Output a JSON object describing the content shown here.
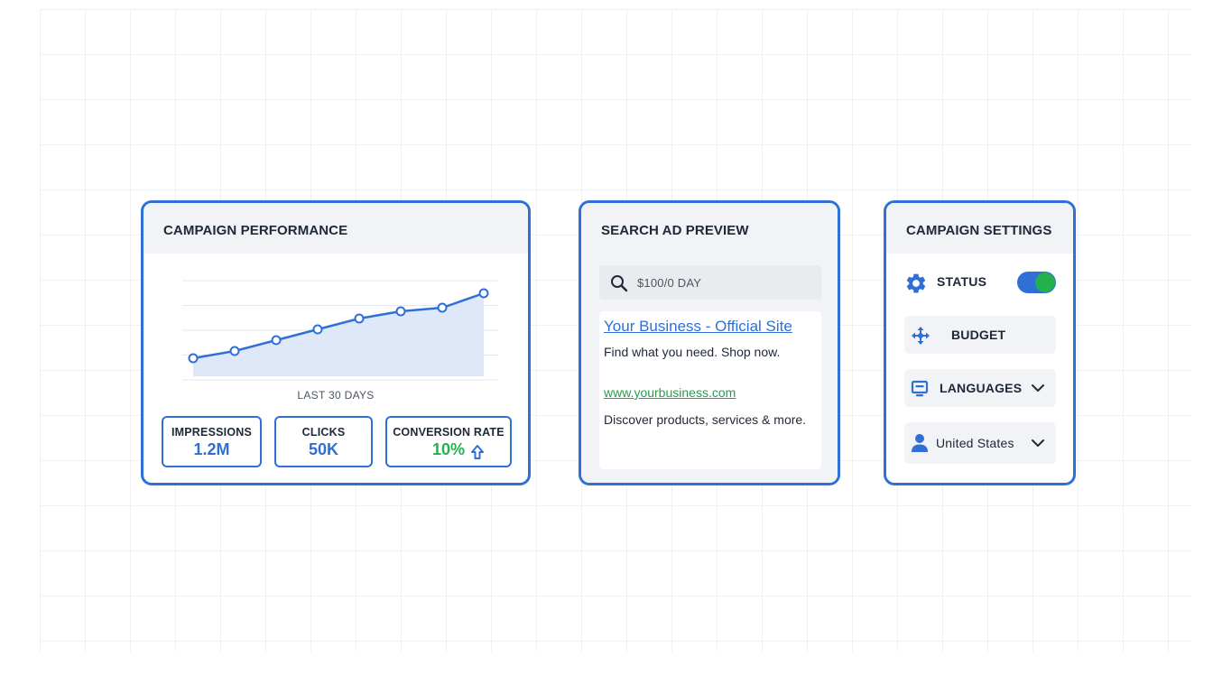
{
  "performance": {
    "title": "CAMPAIGN PERFORMANCE",
    "caption": "LAST 30 DAYS",
    "metrics": [
      {
        "label": "IMPRESSIONS",
        "value": "1.2M"
      },
      {
        "label": "CLICKS",
        "value": "50K"
      },
      {
        "label": "CONVERSION RATE",
        "value": "10%"
      }
    ],
    "trend_icon": "arrow-up-icon"
  },
  "chart_data": {
    "type": "area",
    "title": "",
    "xlabel": "LAST 30 DAYS",
    "ylabel": "",
    "x": [
      1,
      2,
      3,
      4,
      5,
      6,
      7,
      8
    ],
    "series": [
      {
        "values": [
          1.0,
          1.4,
          2.0,
          2.6,
          3.2,
          3.6,
          3.8,
          4.6
        ]
      }
    ],
    "ylim": [
      0,
      5.5
    ],
    "grid": true,
    "colors": {
      "line": "#2f6fd6",
      "fill": "#dfe8f8"
    }
  },
  "ad_preview": {
    "title": "SEARCH AD PREVIEW",
    "search_text": "$100/0 DAY",
    "ad_title": "Your Business - Official Site",
    "ad_desc": "Find what you need. Shop now.",
    "ad_url": "www.yourbusiness.com",
    "ad_desc2": "Discover products, services & more."
  },
  "settings": {
    "title": "CAMPAIGN SETTINGS",
    "status_label": "STATUS",
    "status_on": true,
    "budget_label": "BUDGET",
    "languages_label": "LANGUAGES",
    "location_label": "United States"
  },
  "colors": {
    "accent": "#2f6fd6",
    "success": "#22b14c",
    "panel": "#f1f3f6"
  }
}
